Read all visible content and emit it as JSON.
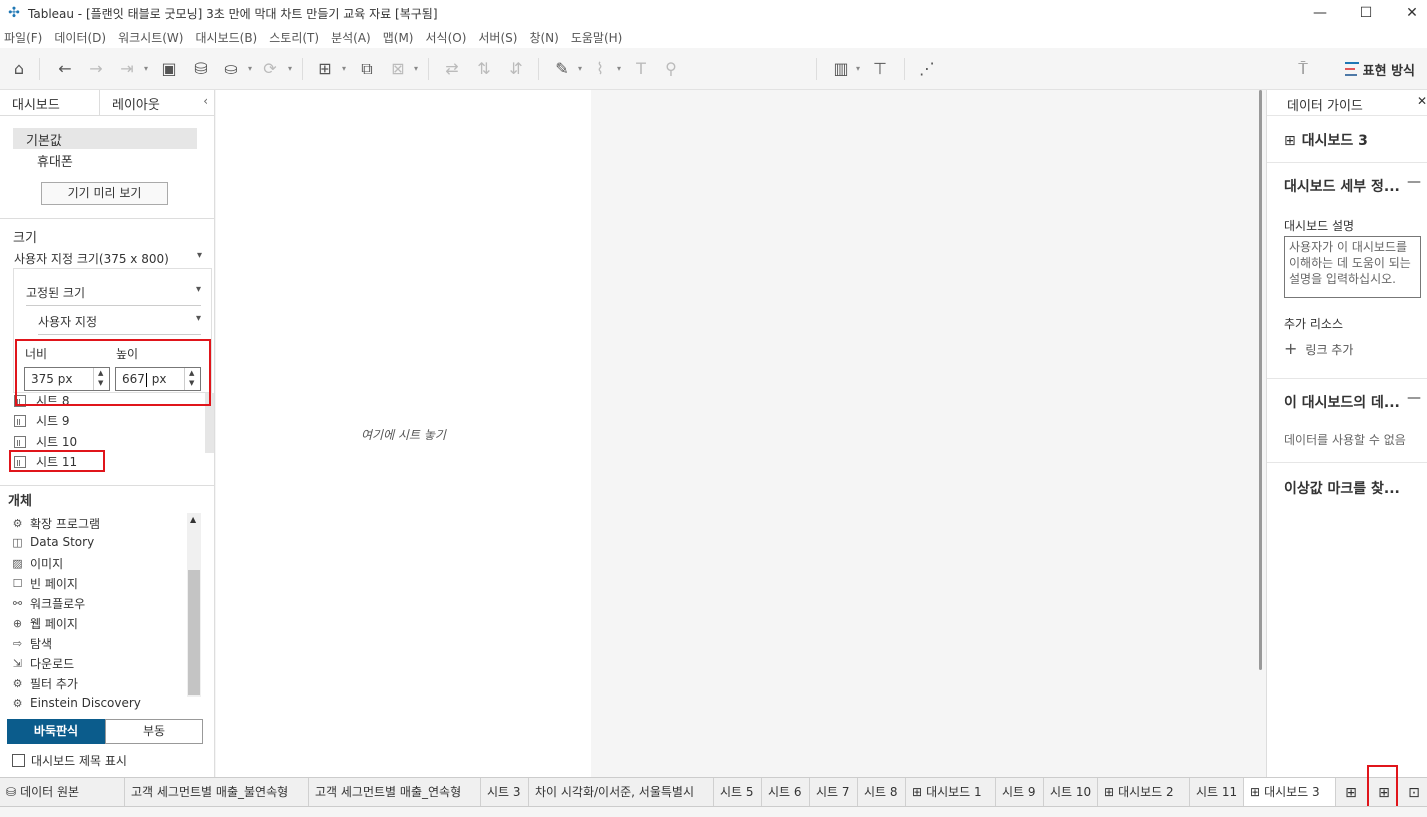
{
  "window": {
    "title": "Tableau - [플랜잇 태블로 굿모닝] 3초 만에 막대 차트 만들기 교육 자료 [복구됨]",
    "minimize": "—",
    "maximize": "☐",
    "close": "✕"
  },
  "menu": [
    "파일(F)",
    "데이터(D)",
    "워크시트(W)",
    "대시보드(B)",
    "스토리(T)",
    "분석(A)",
    "맵(M)",
    "서식(O)",
    "서버(S)",
    "창(N)",
    "도움말(H)"
  ],
  "toolbar": {
    "show_me_label": "표현 방식",
    "show_me_colors": [
      "#1f77b4",
      "#e15759",
      "#4e79a7"
    ]
  },
  "left_panel": {
    "tabs": [
      "대시보드",
      "레이아웃"
    ],
    "devices": [
      "기본값",
      "휴대폰"
    ],
    "preview_button": "기기 미리 보기",
    "size_label": "크기",
    "size_selected": "사용자 지정 크기(375 x 800)",
    "size_popup": {
      "mode": "고정된 크기",
      "preset": "사용자 지정",
      "width_label": "너비",
      "height_label": "높이",
      "width_value": "375 px",
      "height_before_caret": "667",
      "height_after_caret": " px"
    },
    "sheets": [
      "시트 8",
      "시트 9",
      "시트 10",
      "시트 11"
    ],
    "objects_label": "개체",
    "objects": [
      {
        "label": "확장 프로그램",
        "icon": "puzzle-icon"
      },
      {
        "label": "Data Story",
        "icon": "book-icon"
      },
      {
        "label": "이미지",
        "icon": "image-icon"
      },
      {
        "label": "빈 페이지",
        "icon": "blank-icon"
      },
      {
        "label": "워크플로우",
        "icon": "workflow-icon"
      },
      {
        "label": "웹 페이지",
        "icon": "globe-icon"
      },
      {
        "label": "탐색",
        "icon": "navigation-icon"
      },
      {
        "label": "다운로드",
        "icon": "download-icon"
      },
      {
        "label": "필터 추가",
        "icon": "filter-icon"
      },
      {
        "label": "Einstein Discovery",
        "icon": "einstein-icon"
      }
    ],
    "tiled_label": "바둑판식",
    "floating_label": "부동",
    "show_title_label": "대시보드 제목 표시",
    "accent_color": "#0b5c8c",
    "highlight_color": "#e0151b"
  },
  "canvas": {
    "drop_text": "여기에 시트 놓기"
  },
  "right_panel": {
    "header": "데이터 가이드",
    "dashboard_name": "대시보드 3",
    "details_title": "대시보드 세부 정...",
    "desc_label": "대시보드 설명",
    "desc_placeholder": "사용자가 이 대시보드를 이해하는 데 도움이 되는 설명을 입력하십시오.",
    "resources_label": "추가 리소스",
    "add_link": "링크 추가",
    "data_title": "이 대시보드의 데...",
    "no_data": "데이터를 사용할 수 없음",
    "outlier_title": "이상값 마크를 찾..."
  },
  "bottom_tabs": [
    {
      "label": "데이터 원본",
      "type": "datasource",
      "active": false
    },
    {
      "label": "고객 세그먼트별 매출_불연속형",
      "type": "sheet",
      "active": false
    },
    {
      "label": "고객 세그먼트별 매출_연속형",
      "type": "sheet",
      "active": false
    },
    {
      "label": "시트 3",
      "type": "sheet",
      "active": false
    },
    {
      "label": "차이 시각화/이서준, 서울특별시",
      "type": "sheet",
      "active": false
    },
    {
      "label": "시트 5",
      "type": "sheet",
      "active": false
    },
    {
      "label": "시트 6",
      "type": "sheet",
      "active": false
    },
    {
      "label": "시트 7",
      "type": "sheet",
      "active": false
    },
    {
      "label": "시트 8",
      "type": "sheet",
      "active": false
    },
    {
      "label": "대시보드 1",
      "type": "dashboard",
      "active": false
    },
    {
      "label": "시트 9",
      "type": "sheet",
      "active": false
    },
    {
      "label": "시트 10",
      "type": "sheet",
      "active": false
    },
    {
      "label": "대시보드 2",
      "type": "dashboard",
      "active": false
    },
    {
      "label": "시트 11",
      "type": "sheet",
      "active": false
    },
    {
      "label": "대시보드 3",
      "type": "dashboard",
      "active": true
    }
  ]
}
